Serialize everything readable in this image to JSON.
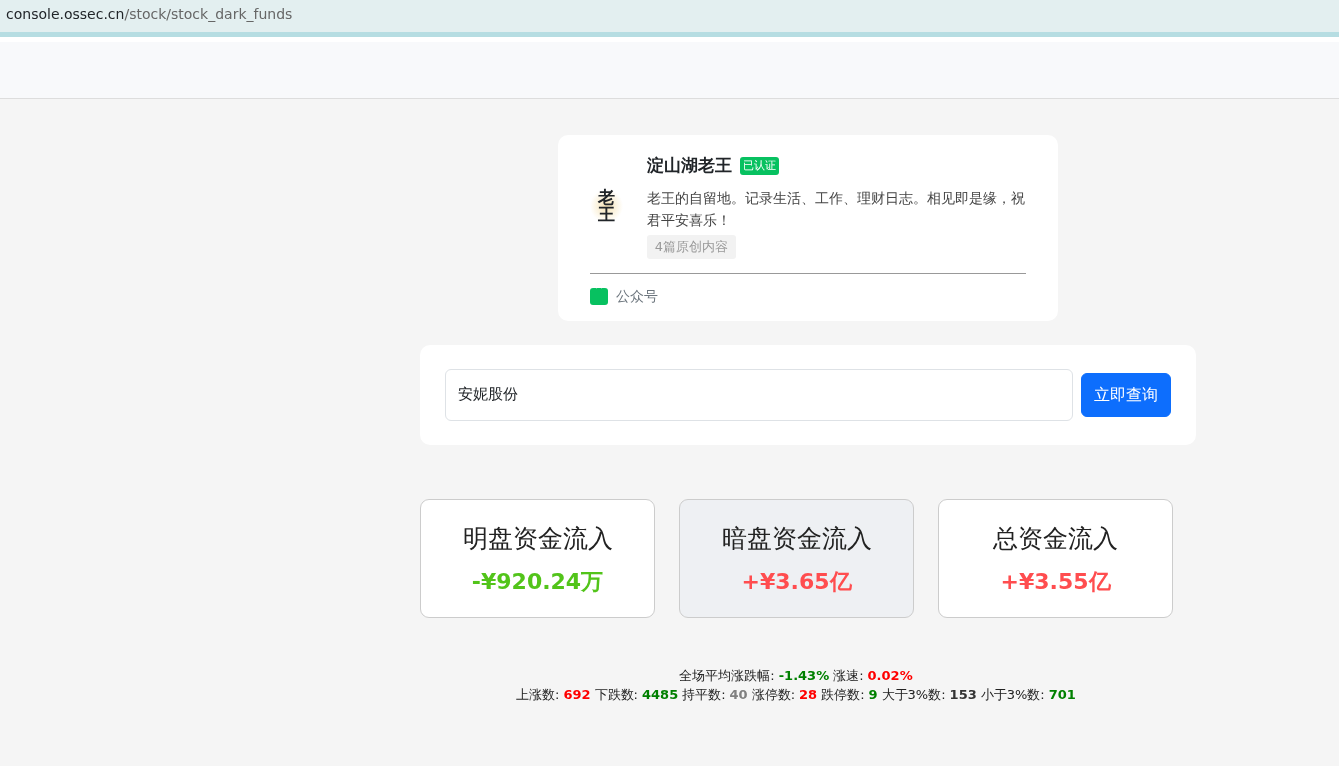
{
  "address_bar": {
    "host": "console.ossec.cn",
    "path": "/stock/stock_dark_funds"
  },
  "profile": {
    "logo_text": "老王",
    "name": "淀山湖老王",
    "verified_badge": "已认证",
    "description": "老王的自留地。记录生活、工作、理财日志。相见即是缘，祝君平安喜乐！",
    "tag": "4篇原创内容",
    "footer_label": "公众号"
  },
  "search": {
    "value": "安妮股份",
    "button": "立即查询"
  },
  "fund_cards": [
    {
      "title": "明盘资金流入",
      "value": "-¥920.24万",
      "color": "#52c41a",
      "highlighted": false
    },
    {
      "title": "暗盘资金流入",
      "value": "+¥3.65亿",
      "color": "#ff4d4f",
      "highlighted": true
    },
    {
      "title": "总资金流入",
      "value": "+¥3.55亿",
      "color": "#ff4d4f",
      "highlighted": false
    }
  ],
  "stats": [
    [
      {
        "label": "全场平均涨跌幅:",
        "value": "-1.43%",
        "color": "#008000"
      },
      {
        "label": "涨速:",
        "value": "0.02%",
        "color": "#ff0000"
      }
    ],
    [
      {
        "label": "上涨数:",
        "value": "692",
        "color": "#ff0000"
      },
      {
        "label": "下跌数:",
        "value": "4485",
        "color": "#008000"
      },
      {
        "label": "持平数:",
        "value": "40",
        "color": "#808080"
      },
      {
        "label": "涨停数:",
        "value": "28",
        "color": "#ff0000"
      },
      {
        "label": "跌停数:",
        "value": "9",
        "color": "#008000"
      },
      {
        "label": "大于3%数:",
        "value": "153",
        "color": "#333333"
      },
      {
        "label": "小于3%数:",
        "value": "701",
        "color": "#008000"
      }
    ]
  ]
}
